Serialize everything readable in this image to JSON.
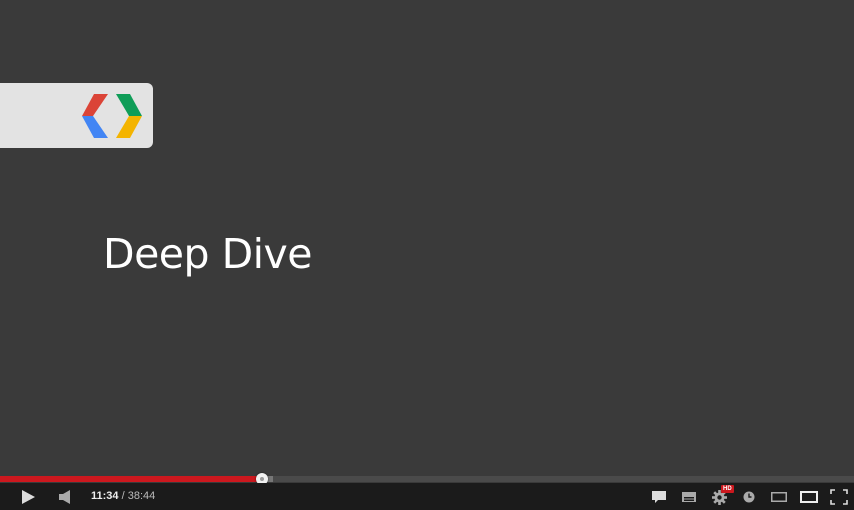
{
  "slide": {
    "title": "Deep Dive",
    "logo_icon": "chrome-devtools-logo-icon"
  },
  "player": {
    "current_time": "11:34",
    "separator": " / ",
    "duration": "38:44",
    "progress_played_fraction": 0.302,
    "progress_buffered_fraction": 0.32,
    "hd_badge": "HD",
    "accent_color": "#cc181e",
    "icons": {
      "play": "play-icon",
      "volume": "volume-icon",
      "annotations": "annotations-icon",
      "captions": "captions-icon",
      "settings": "settings-gear-icon",
      "watch_later": "watch-later-icon",
      "small_player": "small-player-icon",
      "large_player": "large-player-icon",
      "fullscreen": "fullscreen-icon"
    }
  }
}
